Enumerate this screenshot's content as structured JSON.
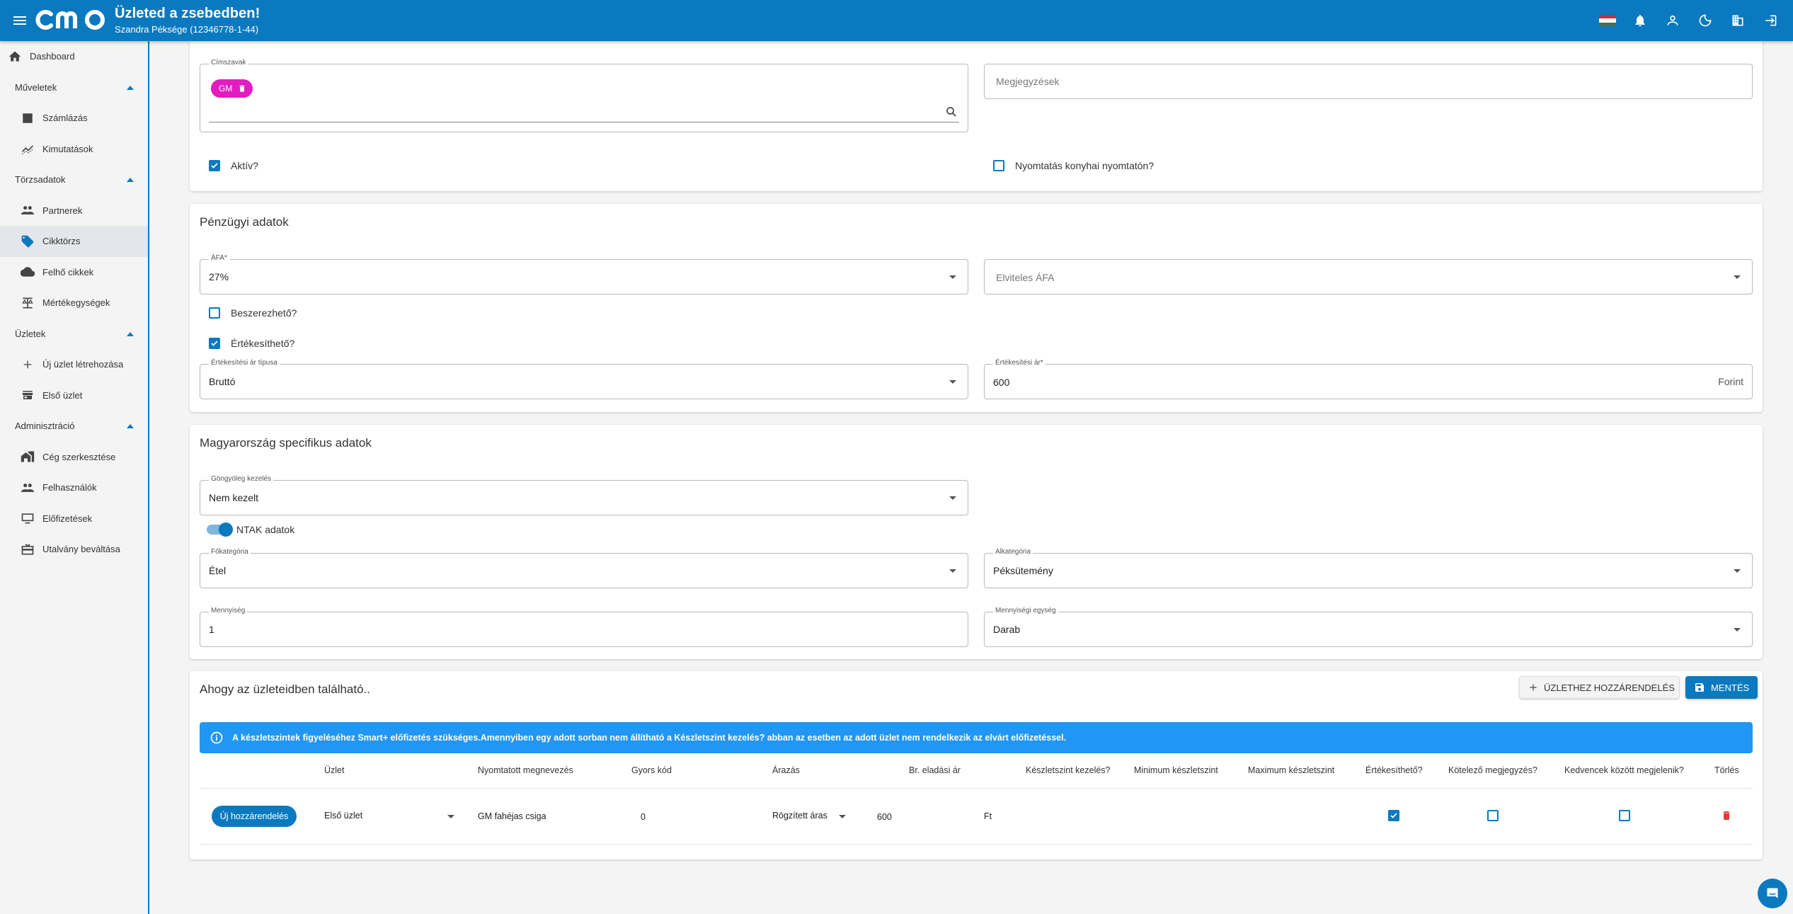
{
  "header": {
    "title": "Üzleted a zsebedben!",
    "subtitle": "Szandra Péksége (12346778-1-44)",
    "logo_text": "cmo",
    "flag_colors": [
      "#ce2939",
      "#ffffff",
      "#477050"
    ]
  },
  "sidebar": {
    "dashboard": "Dashboard",
    "sections": [
      {
        "label": "Műveletek",
        "items": [
          "Számlázás",
          "Kimutatások"
        ]
      },
      {
        "label": "Törzsadatok",
        "items": [
          "Partnerek",
          "Cikktörzs",
          "Felhő cikkek",
          "Mértékegységek"
        ]
      },
      {
        "label": "Üzletek",
        "items": [
          "Új üzlet létrehozása",
          "Első üzlet"
        ]
      },
      {
        "label": "Adminisztráció",
        "items": [
          "Cég szerkesztése",
          "Felhasználók",
          "Előfizetések",
          "Utalvány beváltása"
        ]
      }
    ],
    "active_item": "Cikktörzs"
  },
  "general": {
    "cimszavak_label": "Címszavak",
    "chip_label": "GM",
    "megjegyzesek_placeholder": "Megjegyzések",
    "aktiv_label": "Aktív?",
    "aktiv_checked": true,
    "nyomtatas_label": "Nyomtatás konyhai nyomtatón?",
    "nyomtatas_checked": false
  },
  "financial": {
    "title": "Pénzügyi adatok",
    "afa_label": "ÁFA*",
    "afa_value": "27%",
    "elviteles_placeholder": "Elviteles ÁFA",
    "beszerezheto_label": "Beszerezhető?",
    "beszerezheto_checked": false,
    "ertekesitheto_label": "Értékesíthető?",
    "ertekesitheto_checked": true,
    "ar_tipus_label": "Értékesítési ár típusa",
    "ar_tipus_value": "Bruttó",
    "ar_label": "Értékesítési ár*",
    "ar_value": "600",
    "ar_suffix": "Forint"
  },
  "hungary": {
    "title": "Magyarország specifikus adatok",
    "gongyoleg_label": "Göngyöleg kezelés",
    "gongyoleg_value": "Nem kezelt",
    "ntak_label": "NTAK adatok",
    "ntak_on": true,
    "fokategoria_label": "Főkategória",
    "fokategoria_value": "Étel",
    "alkategoria_label": "Alkategória",
    "alkategoria_value": "Péksütemény",
    "mennyiseg_label": "Mennyiség",
    "mennyiseg_value": "1",
    "mennyisegi_egyseg_label": "Mennyiségi egység",
    "mennyisegi_egyseg_value": "Darab"
  },
  "stores": {
    "title": "Ahogy az üzleteidben található..",
    "assign_button": "ÜZLETHEZ HOZZÁRENDELÉS",
    "save_button": "MENTÉS",
    "info_text": "A készletszintek figyeléséhez Smart+ előfizetés szükséges.Amennyiben egy adott sorban nem állítható a Készletszint kezelés? abban az esetben az adott üzlet nem rendelkezik az elvárt előfizetéssel.",
    "columns": [
      "Üzlet",
      "Nyomtatott megnevezés",
      "Gyors kód",
      "Árazás",
      "Br. eladási ár",
      "Készletszint kezelés?",
      "Minimum készletszint",
      "Maximum készletszint",
      "Értékesíthető?",
      "Kötelező megjegyzés?",
      "Kedvencek között megjelenik?",
      "Törlés"
    ],
    "row": {
      "new_button": "Új hozzárendelés",
      "store": "Első üzlet",
      "printed_name": "GM fahéjas csiga",
      "quick_code": "0",
      "pricing": "Rögzített áras",
      "price": "600",
      "currency": "Ft",
      "sellable": true,
      "mandatory_note": false,
      "favorite": false
    }
  }
}
